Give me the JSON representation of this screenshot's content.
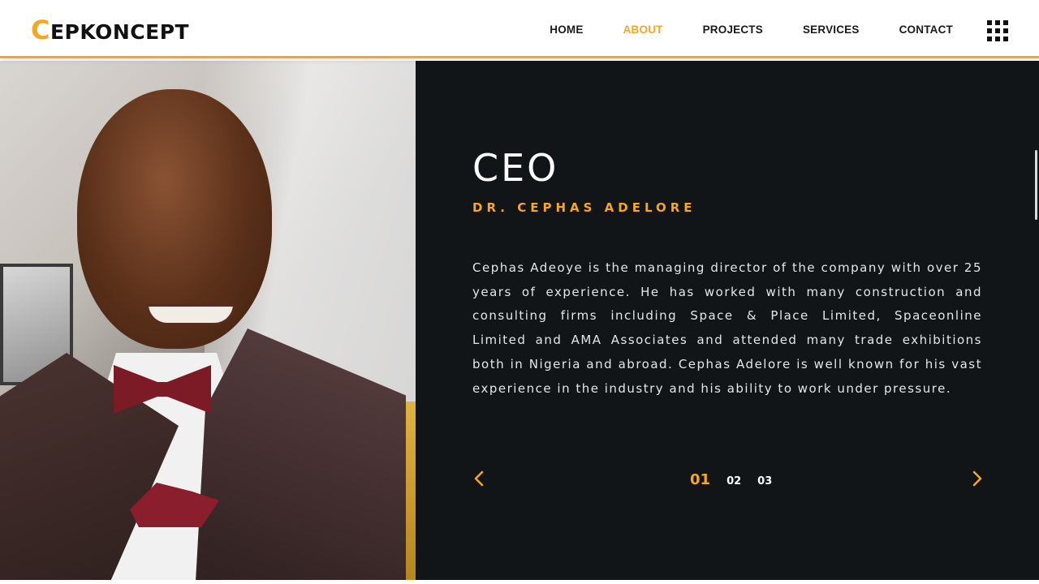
{
  "header": {
    "logo_first": "C",
    "logo_rest": "EPKONCEPT",
    "nav": [
      {
        "label": "HOME"
      },
      {
        "label": "ABOUT"
      },
      {
        "label": "PROJECTS"
      },
      {
        "label": "SERVICES"
      },
      {
        "label": "CONTACT"
      }
    ],
    "active_nav": "ABOUT",
    "menu_icon": "grid-menu-icon"
  },
  "profile": {
    "photo": "portrait of smiling man in tuxedo with bow tie",
    "title": "CEO",
    "name": "DR. CEPHAS ADELORE",
    "bio": "Cephas Adeoye is the managing director of the company with over 25 years of experience. He has worked with many construction and consulting firms including Space & Place Limited, Spaceonline Limited and AMA Associates and attended many trade exhibitions both in Nigeria and abroad. Cephas Adelore is well known for his vast experience in the industry and his ability to work under pressure."
  },
  "pager": {
    "pages": [
      "01",
      "02",
      "03"
    ],
    "active": "01",
    "prev_icon": "chevron-left-icon",
    "next_icon": "chevron-right-icon"
  },
  "colors": {
    "accent": "#f5a623",
    "panel": "#111518",
    "text": "#e6e6e6"
  }
}
